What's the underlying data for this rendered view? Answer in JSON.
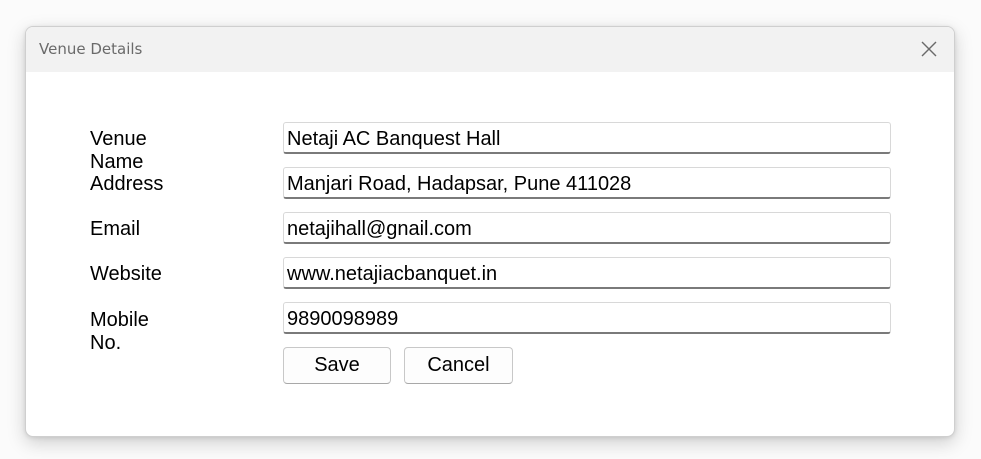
{
  "window": {
    "title": "Venue Details",
    "close_icon": "close-icon"
  },
  "form": {
    "venue_name_label": "Venue Name",
    "venue_name_value": "Netaji AC Banquest Hall",
    "address_label": "Address",
    "address_value": "Manjari Road, Hadapsar, Pune 411028",
    "email_label": "Email",
    "email_value": "netajihall@gnail.com",
    "website_label": "Website",
    "website_value": "www.netajiacbanquet.in",
    "mobile_label": "Mobile No.",
    "mobile_value": "9890098989"
  },
  "buttons": {
    "save_label": "Save",
    "cancel_label": "Cancel"
  }
}
